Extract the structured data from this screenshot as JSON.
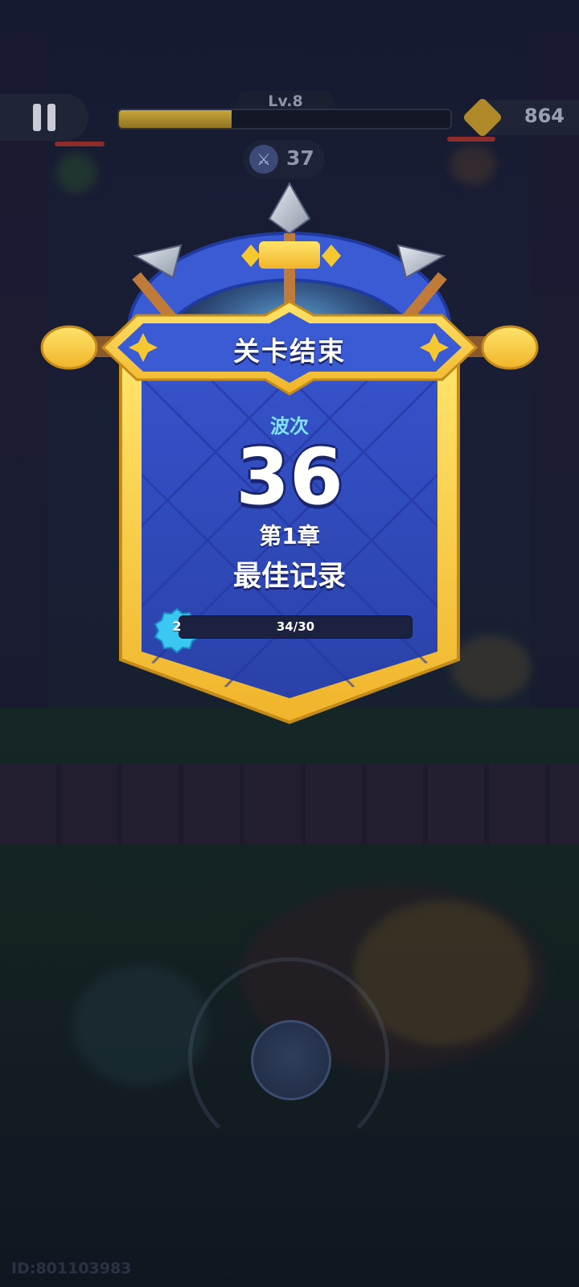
{
  "hud": {
    "level_label": "Lv.8",
    "xp_progress": 0.34,
    "coins": "864",
    "kills": "37",
    "pause_icon": "pause-icon",
    "coin_icon": "gold-coin-icon",
    "kill_icon": "sword-kill-icon"
  },
  "panel": {
    "title": "关卡结束",
    "wave_label": "波次",
    "wave_number": "36",
    "chapter": "第1章",
    "best_record": "最佳记录",
    "progress_text": "34/30",
    "gem_level": "2"
  },
  "footer": {
    "player_id": "ID:801103983"
  },
  "colors": {
    "shield_blue": "#2f4fc0",
    "shield_gold": "#f5c832",
    "title_banner": "#3a5bd3",
    "wave_label": "#7fe3ff"
  }
}
